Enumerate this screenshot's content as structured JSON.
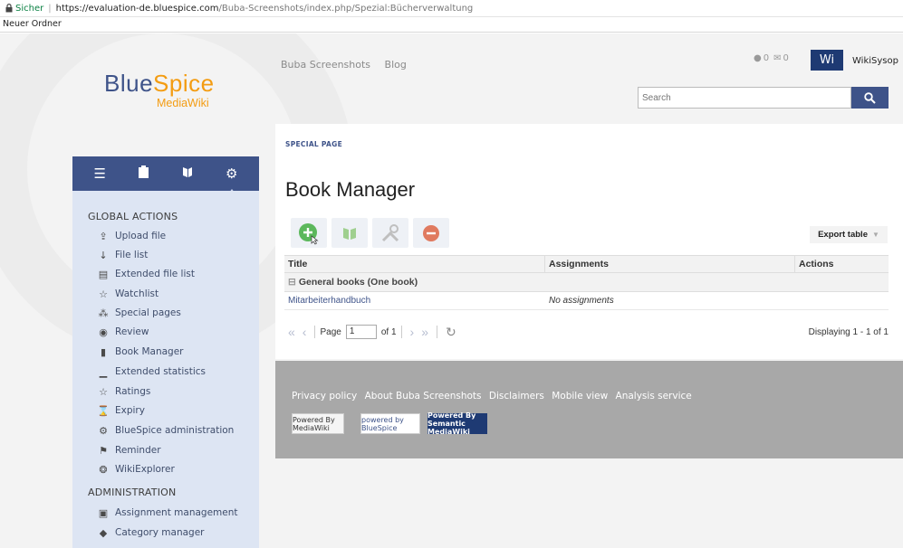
{
  "browser": {
    "secure_label": "Sicher",
    "url_domain": "https://evaluation-de.bluespice.com",
    "url_path": "/Buba-Screenshots/index.php/Spezial:Bücherverwaltung",
    "bookmarks": [
      "Neuer Ordner"
    ]
  },
  "logo": {
    "brand_part1": "Blue",
    "brand_part2": "Spice",
    "sub": "MediaWiki"
  },
  "topnav": [
    "Buba Screenshots",
    "Blog"
  ],
  "user": {
    "avatar_text": "Wi",
    "name": "WikiSysop",
    "notif_count": "0",
    "msg_count": "0"
  },
  "search": {
    "placeholder": "Search"
  },
  "sidebar": {
    "groups": [
      {
        "title": "GLOBAL ACTIONS",
        "items": [
          {
            "label": "Upload file",
            "icon": "upload-icon"
          },
          {
            "label": "File list",
            "icon": "sort-icon"
          },
          {
            "label": "Extended file list",
            "icon": "list-icon"
          },
          {
            "label": "Watchlist",
            "icon": "star-icon"
          },
          {
            "label": "Special pages",
            "icon": "nodes-icon"
          },
          {
            "label": "Review",
            "icon": "eye-icon"
          },
          {
            "label": "Book Manager",
            "icon": "book-icon"
          },
          {
            "label": "Extended statistics",
            "icon": "chart-icon"
          },
          {
            "label": "Ratings",
            "icon": "star-icon"
          },
          {
            "label": "Expiry",
            "icon": "hourglass-icon"
          },
          {
            "label": "BlueSpice administration",
            "icon": "gear-icon"
          },
          {
            "label": "Reminder",
            "icon": "flag-icon"
          },
          {
            "label": "WikiExplorer",
            "icon": "compass-icon"
          }
        ]
      },
      {
        "title": "ADMINISTRATION",
        "items": [
          {
            "label": "Assignment management",
            "icon": "assignment-icon"
          },
          {
            "label": "Category manager",
            "icon": "tag-icon"
          }
        ]
      }
    ]
  },
  "content": {
    "special_label": "SPECIAL PAGE",
    "title": "Book Manager",
    "export_label": "Export table",
    "columns": [
      "Title",
      "Assignments",
      "Actions"
    ],
    "group_label": "General books (One book)",
    "rows": [
      {
        "title": "Mitarbeiterhandbuch",
        "assignments": "No assignments",
        "actions": ""
      }
    ],
    "pager": {
      "page_label": "Page",
      "page_value": "1",
      "of_label": "of 1",
      "display_text": "Displaying 1 - 1 of 1"
    }
  },
  "footer": {
    "links": [
      "Privacy policy",
      "About Buba Screenshots",
      "Disclaimers",
      "Mobile view",
      "Analysis service"
    ],
    "badges": [
      "Powered By MediaWiki",
      "powered by BlueSpice",
      "Powered By Semantic MediaWiki"
    ]
  },
  "colors": {
    "primary": "#3e5389",
    "accent": "#f39c12",
    "add": "#5cb85c",
    "remove": "#e07a5f"
  }
}
